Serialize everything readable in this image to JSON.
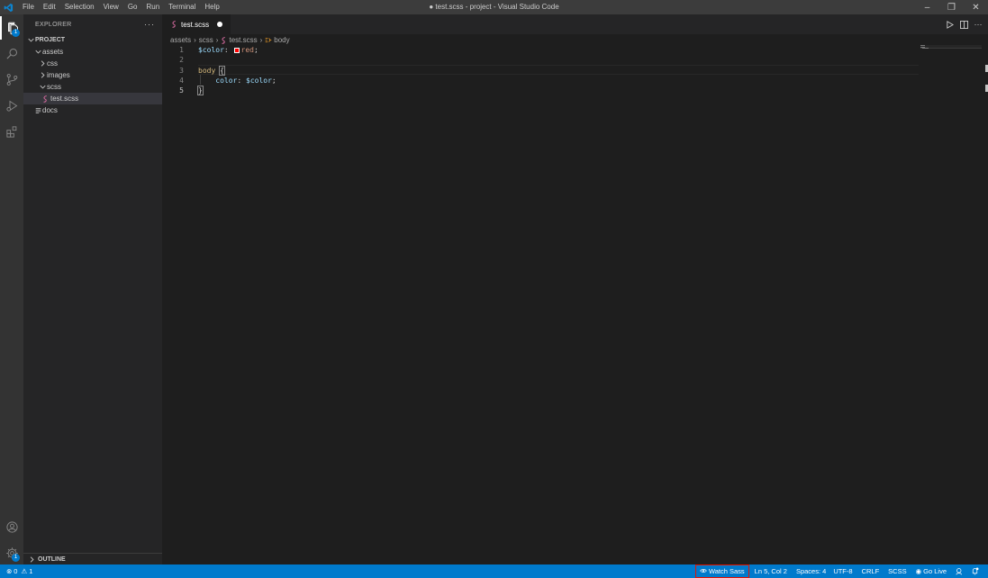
{
  "window": {
    "title": "● test.scss - project - Visual Studio Code",
    "menu": [
      "File",
      "Edit",
      "Selection",
      "View",
      "Go",
      "Run",
      "Terminal",
      "Help"
    ],
    "controls": {
      "minimize": "–",
      "restore": "❐",
      "close": "✕"
    }
  },
  "activity_bar": {
    "explorer_badge": "1",
    "settings_badge": "1"
  },
  "sidebar": {
    "title": "EXPLORER",
    "more": "···",
    "project": "PROJECT",
    "tree": [
      {
        "label": "assets",
        "kind": "folder-open",
        "depth": 1
      },
      {
        "label": "css",
        "kind": "folder",
        "depth": 2
      },
      {
        "label": "images",
        "kind": "folder",
        "depth": 2
      },
      {
        "label": "scss",
        "kind": "folder-open",
        "depth": 2
      },
      {
        "label": "test.scss",
        "kind": "file-scss",
        "depth": 3,
        "selected": true
      },
      {
        "label": "docs",
        "kind": "file-text",
        "depth": 1
      }
    ],
    "outline": "OUTLINE"
  },
  "editor": {
    "tab": {
      "label": "test.scss",
      "dirty": true
    },
    "breadcrumb": [
      "assets",
      "scss",
      "test.scss",
      "body"
    ],
    "lines": [
      {
        "number": "1",
        "parts": [
          {
            "text": "$color",
            "cls": "var"
          },
          {
            "text": ": ",
            "cls": "punct"
          },
          {
            "swatch": true
          },
          {
            "text": "red",
            "cls": "val"
          },
          {
            "text": ";",
            "cls": "punct"
          }
        ]
      },
      {
        "number": "2",
        "parts": []
      },
      {
        "number": "3",
        "parts": [
          {
            "text": "body",
            "cls": "sel"
          },
          {
            "text": " ",
            "cls": "punct"
          },
          {
            "text": "{",
            "cls": "punct",
            "hl": true
          }
        ]
      },
      {
        "number": "4",
        "parts": [
          {
            "text": "    ",
            "cls": "punct"
          },
          {
            "text": "color",
            "cls": "prop"
          },
          {
            "text": ": ",
            "cls": "punct"
          },
          {
            "text": "$color",
            "cls": "var"
          },
          {
            "text": ";",
            "cls": "punct"
          }
        ]
      },
      {
        "number": "5",
        "parts": [
          {
            "text": "}",
            "cls": "punct",
            "hl": true
          },
          {
            "cursor": true
          }
        ],
        "current": true
      }
    ]
  },
  "status_bar": {
    "errors": "0",
    "warnings": "1",
    "watch_sass": "Watch Sass",
    "position": "Ln 5, Col 2",
    "spaces": "Spaces: 4",
    "encoding": "UTF-8",
    "eol": "CRLF",
    "language": "SCSS",
    "go_live": "Go Live"
  },
  "colors": {
    "accent": "#007acc",
    "title_bar": "#3c3c3c",
    "activity_bar": "#333333",
    "sidebar": "#252526",
    "editor": "#1e1e1e",
    "highlight_outline": "#e51400"
  }
}
